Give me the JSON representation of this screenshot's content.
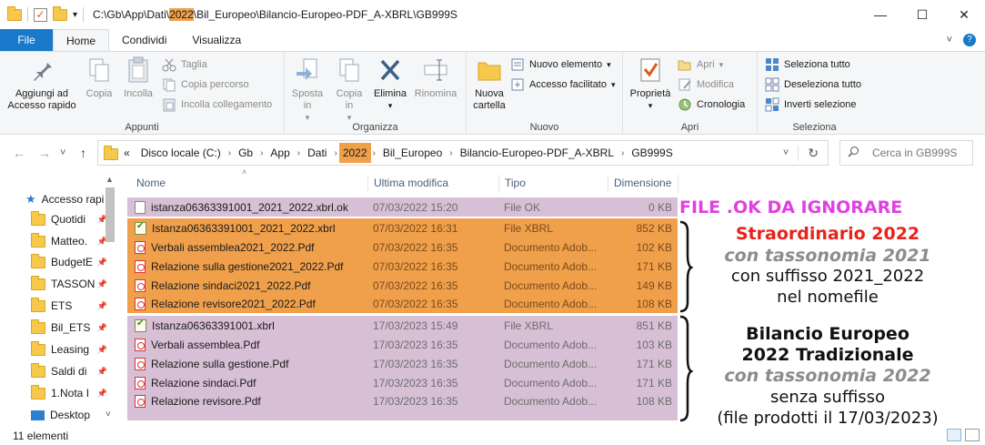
{
  "titlebar": {
    "path_prefix": "C:\\Gb\\App\\Dati\\",
    "path_highlight": "2022",
    "path_suffix": "\\Bil_Europeo\\Bilancio-Europeo-PDF_A-XBRL\\GB999S",
    "minimize": "—",
    "maximize": "☐",
    "close": "✕"
  },
  "tabs": {
    "file": "File",
    "home": "Home",
    "share": "Condividi",
    "view": "Visualizza",
    "expand": "˅",
    "help": "?"
  },
  "ribbon": {
    "appunti": {
      "label": "Appunti",
      "pin": "Aggiungi ad Accesso rapido",
      "copy": "Copia",
      "paste": "Incolla",
      "cut": "Taglia",
      "copy_path": "Copia percorso",
      "paste_link": "Incolla collegamento"
    },
    "organizza": {
      "label": "Organizza",
      "move": "Sposta in",
      "copy_to": "Copia in",
      "delete": "Elimina",
      "rename": "Rinomina"
    },
    "nuovo": {
      "label": "Nuovo",
      "new_folder": "Nuova cartella",
      "new_item": "Nuovo elemento",
      "easy_access": "Accesso facilitato"
    },
    "apri": {
      "label": "Apri",
      "properties": "Proprietà",
      "open": "Apri",
      "edit": "Modifica",
      "history": "Cronologia"
    },
    "seleziona": {
      "label": "Seleziona",
      "select_all": "Seleziona tutto",
      "select_none": "Deseleziona tutto",
      "invert": "Inverti selezione"
    }
  },
  "address": {
    "back": "←",
    "forward": "→",
    "dropdown": "˅",
    "up": "↑",
    "overflow": "«",
    "crumbs": [
      "Disco locale (C:)",
      "Gb",
      "App",
      "Dati",
      "2022",
      "Bil_Europeo",
      "Bilancio-Europeo-PDF_A-XBRL",
      "GB999S"
    ],
    "refresh": "↻",
    "search_placeholder": "Cerca in GB999S"
  },
  "navpane": {
    "items": [
      {
        "label": "Accesso rapi"
      },
      {
        "label": "Quotidi"
      },
      {
        "label": "Matteo."
      },
      {
        "label": "BudgetE"
      },
      {
        "label": "TASSON"
      },
      {
        "label": "ETS"
      },
      {
        "label": "Bil_ETS"
      },
      {
        "label": "Leasing"
      },
      {
        "label": "Saldi di"
      },
      {
        "label": "1.Nota I"
      },
      {
        "label": "Desktop"
      }
    ]
  },
  "columns": {
    "name": "Nome",
    "modified": "Ultima modifica",
    "type": "Tipo",
    "size": "Dimensione"
  },
  "files": [
    {
      "name": "istanza06363391001_2021_2022.xbrl.ok",
      "date": "07/03/2022 15:20",
      "type": "File OK",
      "size": "0 KB",
      "icon": "text-file-icon",
      "group": "ok"
    },
    {
      "name": "Istanza06363391001_2021_2022.xbrl",
      "date": "07/03/2022 16:31",
      "type": "File XBRL",
      "size": "852 KB",
      "icon": "xbrl-file-icon",
      "group": "2021"
    },
    {
      "name": "Verbali assemblea2021_2022.Pdf",
      "date": "07/03/2022 16:35",
      "type": "Documento Adob...",
      "size": "102 KB",
      "icon": "pdf-file-icon",
      "group": "2021"
    },
    {
      "name": "Relazione sulla gestione2021_2022.Pdf",
      "date": "07/03/2022 16:35",
      "type": "Documento Adob...",
      "size": "171 KB",
      "icon": "pdf-file-icon",
      "group": "2021"
    },
    {
      "name": "Relazione sindaci2021_2022.Pdf",
      "date": "07/03/2022 16:35",
      "type": "Documento Adob...",
      "size": "149 KB",
      "icon": "pdf-file-icon",
      "group": "2021"
    },
    {
      "name": "Relazione revisore2021_2022.Pdf",
      "date": "07/03/2022 16:35",
      "type": "Documento Adob...",
      "size": "108 KB",
      "icon": "pdf-file-icon",
      "group": "2021"
    },
    {
      "name": "Istanza06363391001.xbrl",
      "date": "17/03/2023 15:49",
      "type": "File XBRL",
      "size": "851 KB",
      "icon": "xbrl-file-icon",
      "group": "2022"
    },
    {
      "name": "Verbali assemblea.Pdf",
      "date": "17/03/2023 16:35",
      "type": "Documento Adob...",
      "size": "103 KB",
      "icon": "pdf-file-icon",
      "group": "2022"
    },
    {
      "name": "Relazione sulla gestione.Pdf",
      "date": "17/03/2023 16:35",
      "type": "Documento Adob...",
      "size": "171 KB",
      "icon": "pdf-file-icon",
      "group": "2022"
    },
    {
      "name": "Relazione sindaci.Pdf",
      "date": "17/03/2023 16:35",
      "type": "Documento Adob...",
      "size": "171 KB",
      "icon": "pdf-file-icon",
      "group": "2022"
    },
    {
      "name": "Relazione revisore.Pdf",
      "date": "17/03/2023 16:35",
      "type": "Documento Adob...",
      "size": "108 KB",
      "icon": "pdf-file-icon",
      "group": "2022"
    }
  ],
  "annotations": {
    "ok": "FILE .OK DA IGNORARE",
    "g1": [
      "Straordinario 2022",
      "con tassonomia 2021",
      "con suffisso 2021_2022",
      "nel nomefile"
    ],
    "g2": [
      "Bilancio Europeo",
      "2022 Tradizionale",
      "con tassonomia 2022",
      "senza suffisso",
      "(file prodotti il 17/03/2023)"
    ]
  },
  "colors": {
    "orange_highlight": "#f0a04b",
    "purple_highlight": "#d7bfd6",
    "annotation_magenta": "#e040e0",
    "annotation_red": "#e8231b",
    "file_tab_blue": "#1979ca"
  },
  "status": {
    "count": "11 elementi"
  }
}
